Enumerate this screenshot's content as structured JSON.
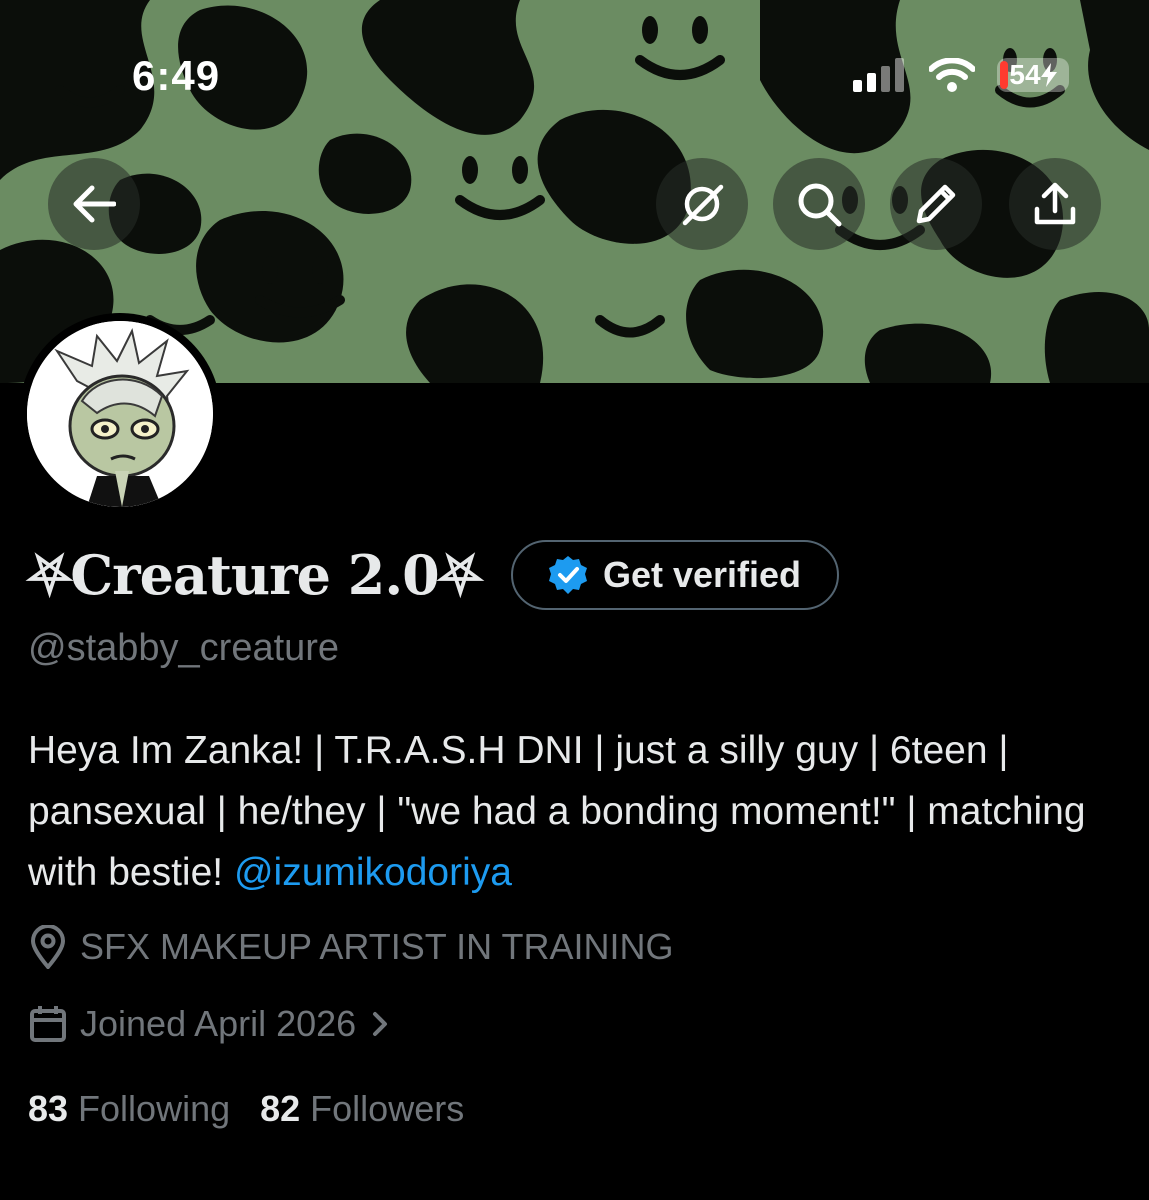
{
  "status_bar": {
    "time": "6:49",
    "battery": "54"
  },
  "header_icons": [
    "back-arrow-icon",
    "grok-icon",
    "search-icon",
    "pencil-icon",
    "share-icon"
  ],
  "profile": {
    "display_name": "⛧Creature 2.0⛧",
    "verify_label": "Get verified",
    "handle": "@stabby_creature",
    "bio_text": "Heya Im Zanka! | T.R.A.S.H DNI | just a silly guy | 6teen | pansexual | he/they | \"we had a bonding moment!\" | matching with bestie! ",
    "bio_mention": "@izumikodoriya",
    "location": "SFX MAKEUP ARTIST IN TRAINING",
    "joined": "Joined April 2026",
    "following_count": "83",
    "following_label": "Following",
    "followers_count": "82",
    "followers_label": "Followers"
  },
  "colors": {
    "background": "#000000",
    "banner_green": "#7aa070",
    "link": "#1d9bf0",
    "muted": "#71767b",
    "verified_badge": "#1d9bf0"
  }
}
